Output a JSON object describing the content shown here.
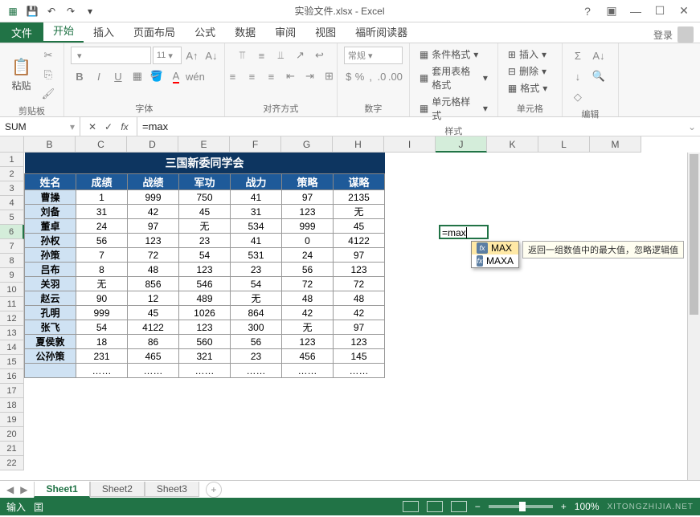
{
  "window": {
    "title": "实验文件.xlsx - Excel"
  },
  "ribbon": {
    "file": "文件",
    "tabs": [
      "开始",
      "插入",
      "页面布局",
      "公式",
      "数据",
      "审阅",
      "视图",
      "福昕阅读器"
    ],
    "active_tab": "开始",
    "login": "登录",
    "groups": {
      "clipboard": {
        "label": "剪贴板",
        "paste": "粘贴"
      },
      "font": {
        "label": "字体",
        "size": "11"
      },
      "alignment": {
        "label": "对齐方式"
      },
      "number": {
        "label": "数字",
        "format": "常规"
      },
      "styles": {
        "label": "样式",
        "conditional": "条件格式",
        "table": "套用表格格式",
        "cell": "单元格样式"
      },
      "cells": {
        "label": "单元格",
        "insert": "插入",
        "delete": "删除",
        "format": "格式"
      },
      "editing": {
        "label": "编辑"
      }
    }
  },
  "formula_bar": {
    "name_box": "SUM",
    "formula": "=max"
  },
  "grid": {
    "columns": [
      "B",
      "C",
      "D",
      "E",
      "F",
      "G",
      "H",
      "I",
      "J",
      "K",
      "L",
      "M"
    ],
    "active_col": "J",
    "active_row": 6,
    "rows": [
      1,
      2,
      3,
      4,
      5,
      6,
      7,
      8,
      9,
      10,
      11,
      12,
      13,
      14,
      15,
      16,
      17,
      18,
      19,
      20,
      21,
      22
    ],
    "active_cell_value": "=max"
  },
  "table": {
    "title": "三国新委同学会",
    "headers": [
      "姓名",
      "成绩",
      "战绩",
      "军功",
      "战力",
      "策略",
      "谋略"
    ],
    "rows": [
      [
        "曹操",
        "1",
        "999",
        "750",
        "41",
        "97",
        "2135"
      ],
      [
        "刘备",
        "31",
        "42",
        "45",
        "31",
        "123",
        "无"
      ],
      [
        "董卓",
        "24",
        "97",
        "无",
        "534",
        "999",
        "45"
      ],
      [
        "孙权",
        "56",
        "123",
        "23",
        "41",
        "0",
        "4122"
      ],
      [
        "孙策",
        "7",
        "72",
        "54",
        "531",
        "24",
        "97"
      ],
      [
        "吕布",
        "8",
        "48",
        "123",
        "23",
        "56",
        "123"
      ],
      [
        "关羽",
        "无",
        "856",
        "546",
        "54",
        "72",
        "72"
      ],
      [
        "赵云",
        "90",
        "12",
        "489",
        "无",
        "48",
        "48"
      ],
      [
        "孔明",
        "999",
        "45",
        "1026",
        "864",
        "42",
        "42"
      ],
      [
        "张飞",
        "54",
        "4122",
        "123",
        "300",
        "无",
        "97"
      ],
      [
        "夏侯敦",
        "18",
        "86",
        "560",
        "56",
        "123",
        "123"
      ],
      [
        "公孙策",
        "231",
        "465",
        "321",
        "23",
        "456",
        "145"
      ],
      [
        "",
        "……",
        "……",
        "……",
        "……",
        "……",
        "……"
      ]
    ]
  },
  "tooltip": {
    "items": [
      "MAX",
      "MAXA"
    ],
    "selected": "MAX",
    "desc": "返回一组数值中的最大值，忽略逻辑值"
  },
  "sheets": {
    "tabs": [
      "Sheet1",
      "Sheet2",
      "Sheet3"
    ],
    "active": "Sheet1"
  },
  "status": {
    "mode": "输入",
    "zoom": "100%"
  }
}
